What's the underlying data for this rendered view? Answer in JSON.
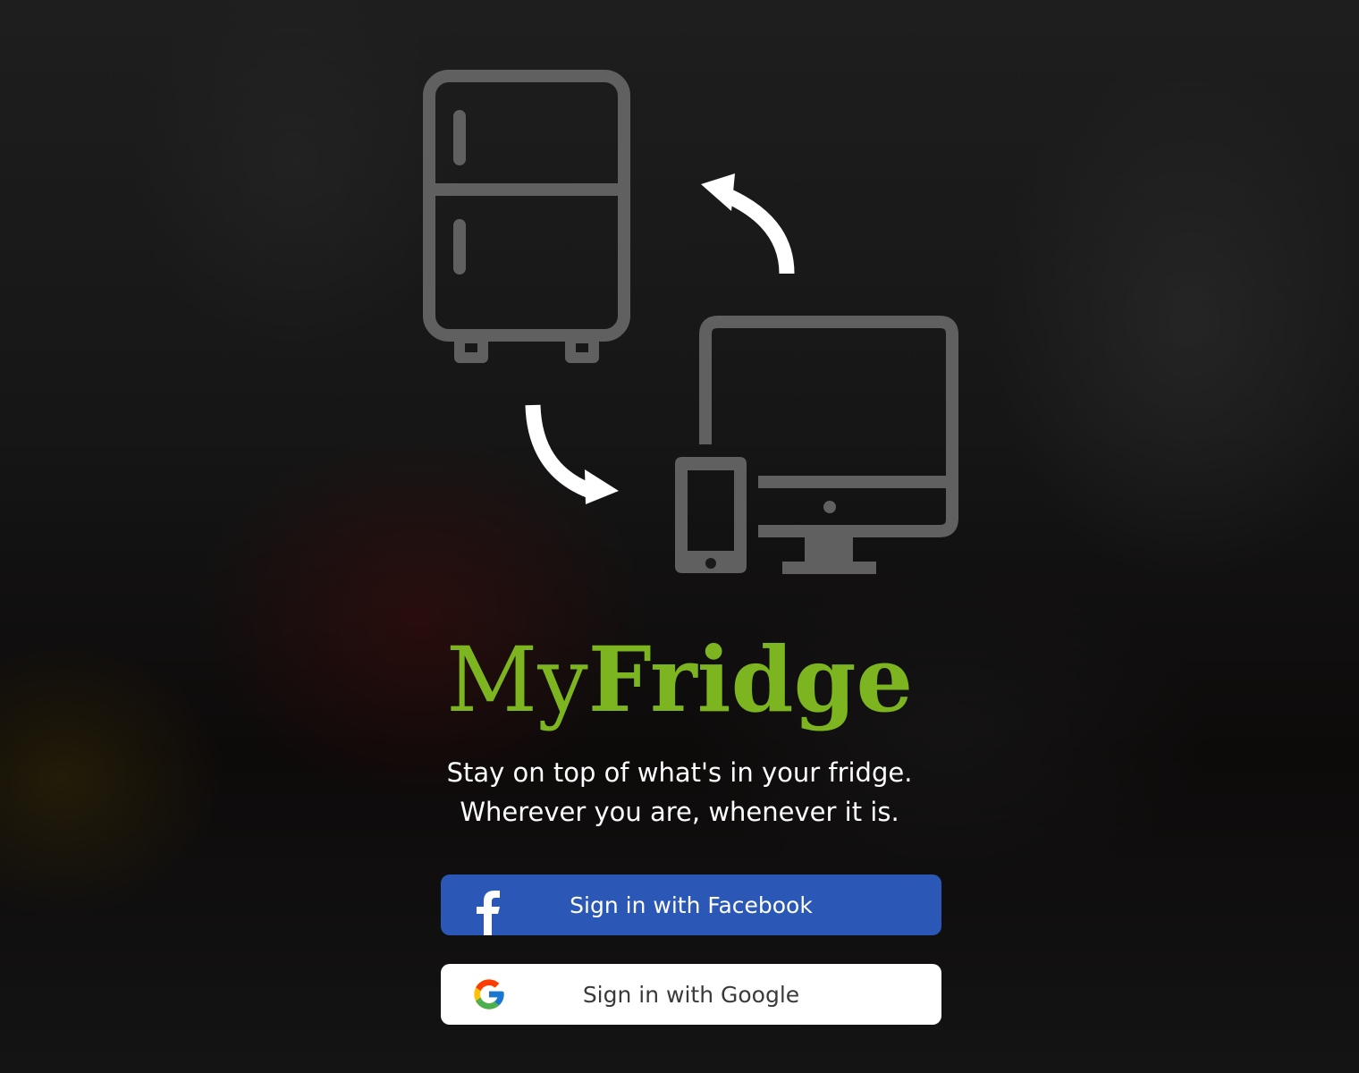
{
  "app": {
    "logo_light": "My",
    "logo_bold": "Fridge",
    "tagline_line1": "Stay on top of what's in your fridge.",
    "tagline_line2": "Wherever you are, whenever it is."
  },
  "auth": {
    "facebook_label": "Sign in with Facebook",
    "google_label": "Sign in with Google"
  },
  "icons": {
    "hero": [
      "fridge-icon",
      "sync-arrow-icon",
      "desktop-monitor-icon",
      "smartphone-icon"
    ],
    "facebook": "facebook-icon",
    "google": "google-icon"
  },
  "colors": {
    "brand_green": "#7cb51f",
    "facebook_blue": "#2b58b6",
    "icon_gray": "#606060",
    "arrow_white": "#ffffff"
  }
}
